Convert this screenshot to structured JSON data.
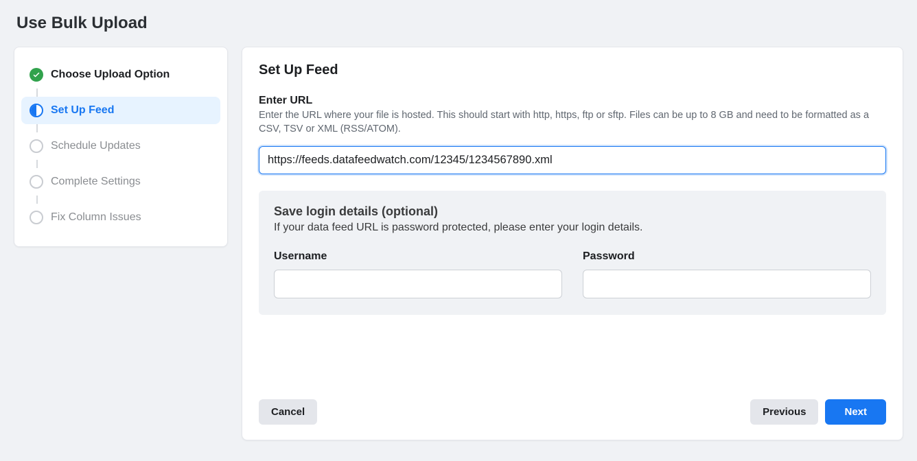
{
  "page": {
    "title": "Use Bulk Upload"
  },
  "stepper": {
    "steps": [
      {
        "label": "Choose Upload Option",
        "state": "completed"
      },
      {
        "label": "Set Up Feed",
        "state": "active"
      },
      {
        "label": "Schedule Updates",
        "state": "pending"
      },
      {
        "label": "Complete Settings",
        "state": "pending"
      },
      {
        "label": "Fix Column Issues",
        "state": "pending"
      }
    ]
  },
  "main": {
    "heading": "Set Up Feed",
    "url_section": {
      "label": "Enter URL",
      "description": "Enter the URL where your file is hosted. This should start with http, https, ftp or sftp. Files can be up to 8 GB and need to be formatted as a CSV, TSV or XML (RSS/ATOM).",
      "value": "https://feeds.datafeedwatch.com/12345/1234567890.xml"
    },
    "login_section": {
      "title": "Save login details (optional)",
      "description": "If your data feed URL is password protected, please enter your login details.",
      "username_label": "Username",
      "username_value": "",
      "password_label": "Password",
      "password_value": ""
    }
  },
  "footer": {
    "cancel_label": "Cancel",
    "previous_label": "Previous",
    "next_label": "Next"
  }
}
